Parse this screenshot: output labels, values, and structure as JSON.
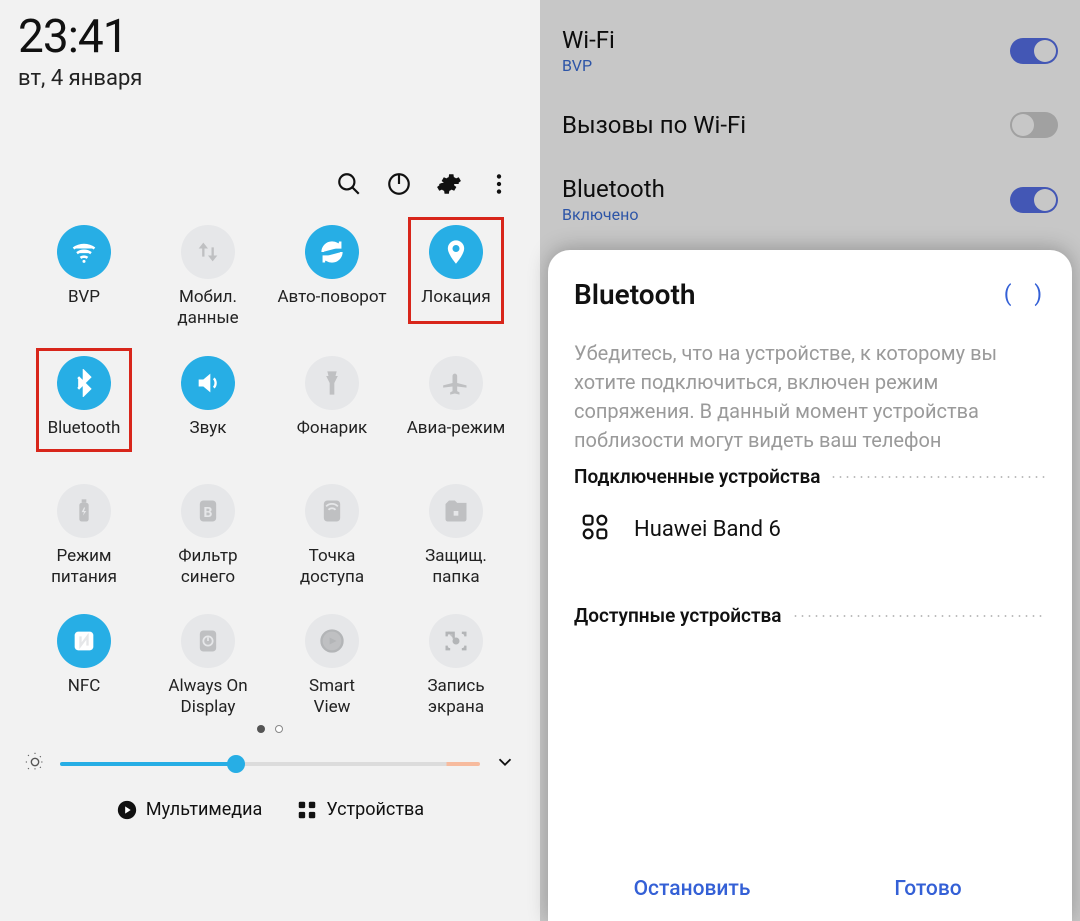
{
  "left": {
    "time": "23:41",
    "date": "вт, 4 января",
    "tiles": [
      {
        "id": "wifi",
        "label": "BVP",
        "active": true,
        "icon": "wifi"
      },
      {
        "id": "mobile-data",
        "label": "Мобил. данные",
        "active": false,
        "icon": "updown"
      },
      {
        "id": "auto-rotate",
        "label": "Авто-поворот",
        "active": true,
        "icon": "rotate"
      },
      {
        "id": "location",
        "label": "Локация",
        "active": true,
        "icon": "pin",
        "highlight": true
      },
      {
        "id": "bluetooth",
        "label": "Bluetooth",
        "active": true,
        "icon": "bt",
        "highlight": true
      },
      {
        "id": "sound",
        "label": "Звук",
        "active": true,
        "icon": "speaker"
      },
      {
        "id": "flashlight",
        "label": "Фонарик",
        "active": false,
        "icon": "flash"
      },
      {
        "id": "airplane",
        "label": "Авиа-режим",
        "active": false,
        "icon": "plane"
      },
      {
        "id": "power-mode",
        "label": "Режим питания",
        "active": false,
        "icon": "battery"
      },
      {
        "id": "blue-filter",
        "label": "Фильтр синего",
        "active": false,
        "icon": "b"
      },
      {
        "id": "hotspot",
        "label": "Точка доступа",
        "active": false,
        "icon": "hotspot"
      },
      {
        "id": "secure-folder",
        "label": "Защищ. папка",
        "active": false,
        "icon": "folder"
      },
      {
        "id": "nfc",
        "label": "NFC",
        "active": true,
        "icon": "nfc"
      },
      {
        "id": "aod",
        "label": "Always On Display",
        "active": false,
        "icon": "clock"
      },
      {
        "id": "smart-view",
        "label": "Smart View",
        "active": false,
        "icon": "smartview"
      },
      {
        "id": "screen-record",
        "label": "Запись экрана",
        "active": false,
        "icon": "record"
      }
    ],
    "brightness_percent": 42,
    "bottom": {
      "media": "Мультимедиа",
      "devices": "Устройства"
    }
  },
  "right": {
    "settings": [
      {
        "id": "wifi",
        "title": "Wi-Fi",
        "subtitle": "BVP",
        "on": true
      },
      {
        "id": "wifi-calling",
        "title": "Вызовы по Wi-Fi",
        "subtitle": "",
        "on": false
      },
      {
        "id": "bluetooth",
        "title": "Bluetooth",
        "subtitle": "Включено",
        "on": true
      }
    ],
    "sheet": {
      "title": "Bluetooth",
      "description": "Убедитесь, что на устройстве, к которому вы хотите подключиться, включен режим сопряжения. В данный момент устройства поблизости могут видеть ваш телефон",
      "section_paired": "Подключенные устройства",
      "section_available": "Доступные устройства",
      "device": "Huawei Band 6",
      "stop": "Остановить",
      "done": "Готово"
    }
  }
}
